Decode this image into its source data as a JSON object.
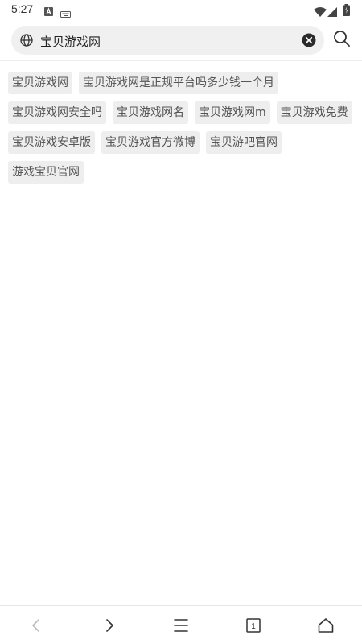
{
  "status_bar": {
    "time": "5:27",
    "icons": [
      "a-notification-icon",
      "keyboard-icon",
      "wifi-icon",
      "signal-icon",
      "battery-icon"
    ]
  },
  "search": {
    "value": "宝贝游戏网",
    "icons": [
      "globe-icon",
      "clear-icon",
      "search-icon"
    ]
  },
  "suggestions": [
    "宝贝游戏网",
    "宝贝游戏网是正规平台吗多少钱一个月",
    "宝贝游戏网安全吗",
    "宝贝游戏网名",
    "宝贝游戏网m",
    "宝贝游戏免费",
    "宝贝游戏安卓版",
    "宝贝游戏官方微博",
    "宝贝游吧官网",
    "游戏宝贝官网"
  ],
  "bottom_nav": {
    "items": [
      "back-icon",
      "forward-icon",
      "menu-icon",
      "tabs-icon",
      "home-icon"
    ],
    "tab_count": "1"
  },
  "colors": {
    "search_bg": "#f0f0f0",
    "chip_bg": "#eeeeee",
    "chip_text": "#555555",
    "icon_dark": "#333333",
    "icon_disabled": "#bbbbbb"
  }
}
